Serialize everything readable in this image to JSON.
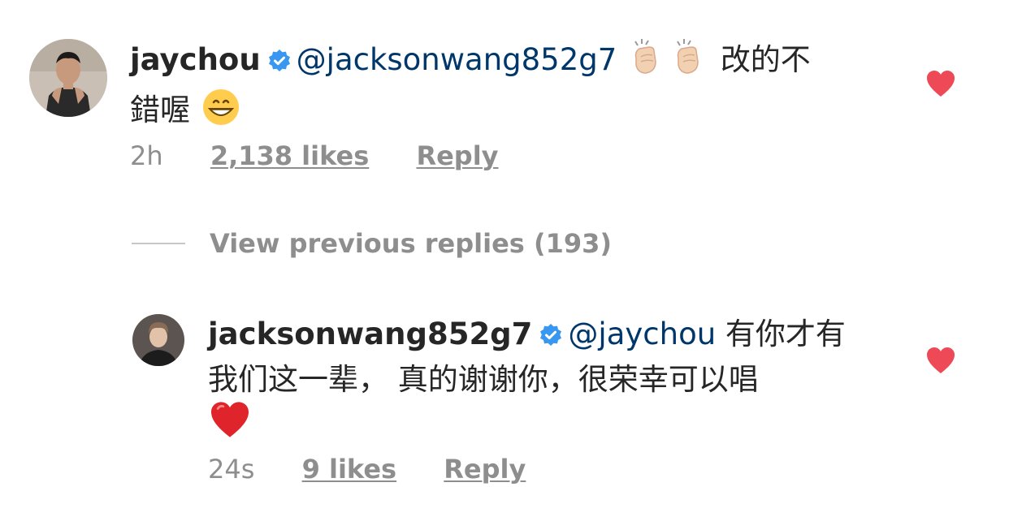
{
  "comments": [
    {
      "username": "jaychou",
      "verified": true,
      "mention": "@jacksonwang852g7",
      "text_after_emoji": "改的不",
      "text_line2": "錯喔",
      "emojis": [
        "clapping-hands",
        "clapping-hands",
        "grinning-face"
      ],
      "time": "2h",
      "likes": "2,138 likes",
      "reply": "Reply",
      "liked": true
    },
    {
      "username": "jacksonwang852g7",
      "verified": true,
      "mention": "@jaychou",
      "text_line1": "有你才有",
      "text_line2": "我们这一辈， 真的谢谢你，很荣幸可以唱",
      "emojis": [
        "red-heart"
      ],
      "time": "24s",
      "likes": "9 likes",
      "reply": "Reply",
      "liked": true
    }
  ],
  "view_previous": "View previous replies (193)",
  "colors": {
    "text": "#262626",
    "mention": "#00376b",
    "meta": "#8e8e8e",
    "like_red": "#ed4956",
    "verified_blue": "#3897f0"
  }
}
